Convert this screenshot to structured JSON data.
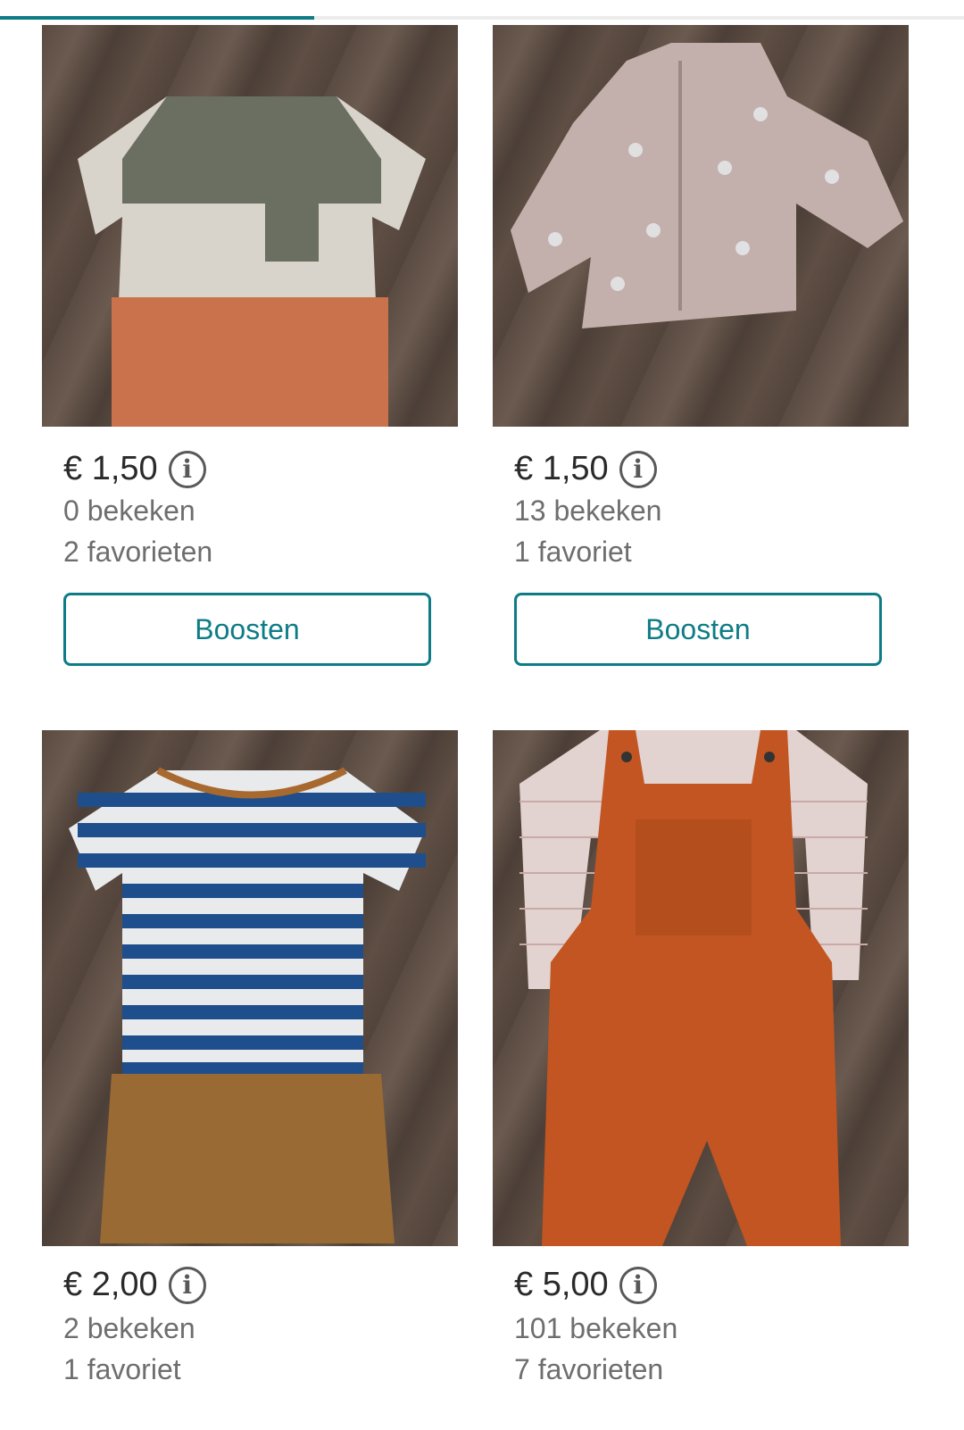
{
  "progress": {
    "fraction": 0.326,
    "color": "#0e7c86"
  },
  "accent_color": "#0e7c86",
  "listings": [
    {
      "price": "€ 1,50",
      "views": "0 bekeken",
      "favorites": "2 favorieten",
      "boost_label": "Boosten",
      "image": "baby-tshirt-grey-white-orange",
      "info_icon": "info-icon"
    },
    {
      "price": "€ 1,50",
      "views": "13 bekeken",
      "favorites": "1 favoriet",
      "boost_label": "Boosten",
      "image": "pink-quilted-bunny-jacket",
      "info_icon": "info-icon"
    },
    {
      "price": "€ 2,00",
      "views": "2 bekeken",
      "favorites": "1 favoriet",
      "image": "striped-tshirt-and-brown-shorts",
      "info_icon": "info-icon"
    },
    {
      "price": "€ 5,00",
      "views": "101 bekeken",
      "favorites": "7 favorieten",
      "image": "orange-dungarees-with-striped-shirt",
      "info_icon": "info-icon"
    }
  ]
}
